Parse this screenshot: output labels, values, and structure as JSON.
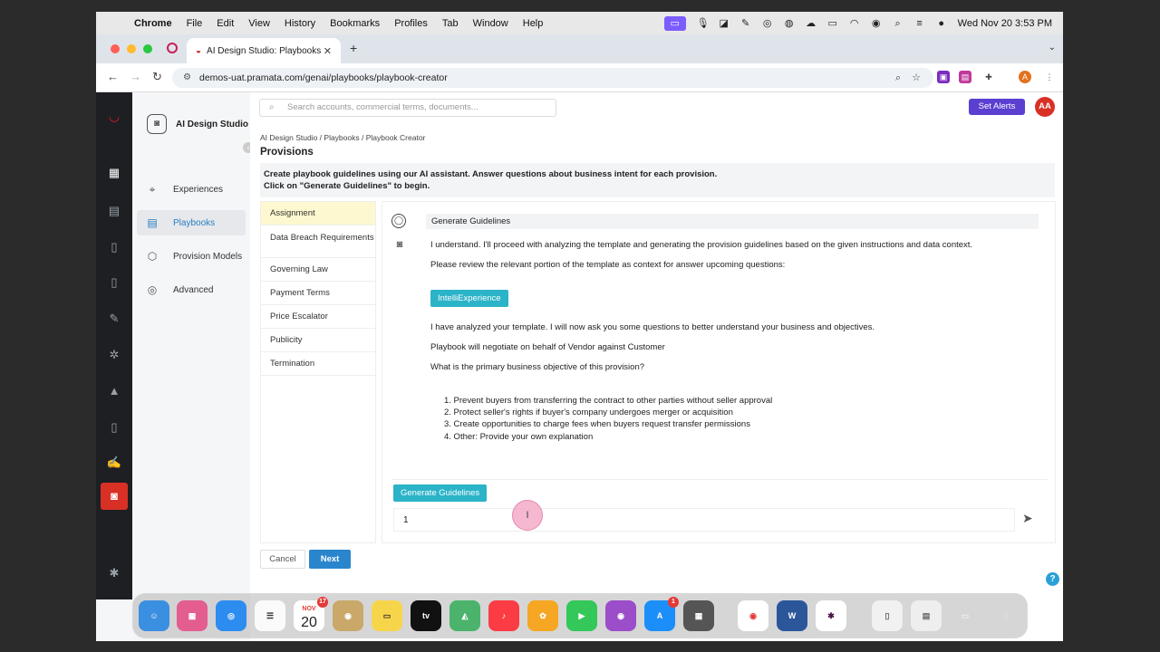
{
  "menubar": {
    "app": "Chrome",
    "items": [
      "File",
      "Edit",
      "View",
      "History",
      "Bookmarks",
      "Profiles",
      "Tab",
      "Window",
      "Help"
    ],
    "clock": "Wed Nov 20  3:53 PM"
  },
  "browser": {
    "tab_title": "AI Design Studio: Playbooks",
    "url": "demos-uat.pramata.com/genai/playbooks/playbook-creator",
    "profile_initial": "A"
  },
  "sidebar": {
    "brand": "AI Design Studio",
    "items": [
      {
        "label": "Experiences",
        "icon": "experiences-icon"
      },
      {
        "label": "Playbooks",
        "icon": "playbooks-icon"
      },
      {
        "label": "Provision Models",
        "icon": "provision-models-icon"
      },
      {
        "label": "Advanced",
        "icon": "advanced-icon"
      }
    ]
  },
  "header": {
    "search_placeholder": "Search accounts, commercial terms, documents...",
    "alerts_label": "Set Alerts",
    "avatar_initials": "AA"
  },
  "page": {
    "breadcrumb": "AI Design Studio / Playbooks / Playbook Creator",
    "title": "Provisions",
    "intro_line1": "Create playbook guidelines using our AI assistant. Answer questions about business intent for each provision.",
    "intro_line2": "Click on \"Generate Guidelines\" to begin."
  },
  "provisions": [
    "Assignment",
    "Data Breach Requirements",
    "Governing Law",
    "Payment Terms",
    "Price Escalator",
    "Publicity",
    "Termination"
  ],
  "chat": {
    "user_message": "Generate Guidelines",
    "bot_msg1": "I understand. I'll proceed with analyzing the template and generating the provision guidelines based on the given instructions and data context.",
    "bot_msg2": "Please review the relevant portion of the template as context for answer upcoming questions:",
    "chip_label": "IntelliExperience",
    "bot_msg3": "I have analyzed your template. I will now ask you some questions to better understand your business and objectives.",
    "bot_msg4": "Playbook will negotiate on behalf of Vendor against Customer",
    "bot_msg5": "What is the primary business objective of this provision?",
    "options": [
      "1. Prevent buyers from transferring the contract to other parties without seller approval",
      "2. Protect seller's rights if buyer's company undergoes merger or acquisition",
      "3. Create opportunities to charge fees when buyers request transfer permissions",
      "4. Other: Provide your own explanation"
    ],
    "generate_button": "Generate Guidelines",
    "input_value": "1"
  },
  "footer": {
    "cancel": "Cancel",
    "next": "Next",
    "help": "?"
  },
  "dock": {
    "calendar_month": "NOV",
    "calendar_day": "20",
    "calendar_badge": "17",
    "appstore_badge": "1"
  }
}
